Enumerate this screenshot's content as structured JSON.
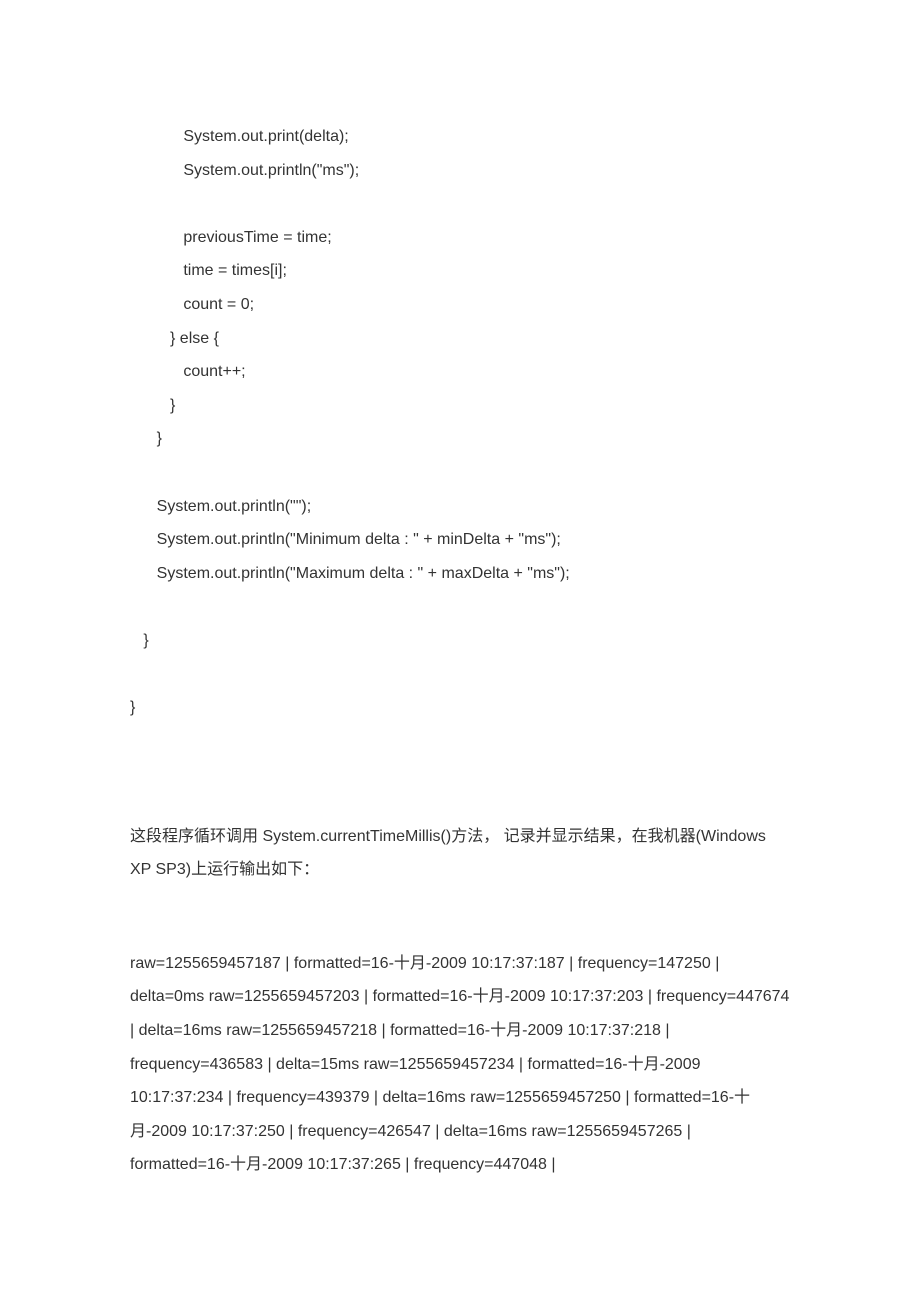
{
  "code": "            System.out.print(delta);\n            System.out.println(\"ms\");\n\n            previousTime = time;\n            time = times[i];\n            count = 0;\n         } else {\n            count++;\n         }\n      }\n\n      System.out.println(\"\");\n      System.out.println(\"Minimum delta : \" + minDelta + \"ms\");\n      System.out.println(\"Maximum delta : \" + maxDelta + \"ms\");\n\n   }\n\n}",
  "paragraph": "这段程序循环调用 System.currentTimeMillis()方法， 记录并显示结果，在我机器(Windows XP SP3)上运行输出如下：",
  "output": "raw=1255659457187 | formatted=16-十月-2009 10:17:37:187 | frequency=147250 | delta=0ms\nraw=1255659457203 | formatted=16-十月-2009 10:17:37:203 | frequency=447674 | delta=16ms\nraw=1255659457218 | formatted=16-十月-2009 10:17:37:218 | frequency=436583 | delta=15ms\nraw=1255659457234 | formatted=16-十月-2009 10:17:37:234 | frequency=439379 | delta=16ms\nraw=1255659457250 | formatted=16-十月-2009 10:17:37:250 | frequency=426547 | delta=16ms\nraw=1255659457265 | formatted=16-十月-2009 10:17:37:265 | frequency=447048 |"
}
